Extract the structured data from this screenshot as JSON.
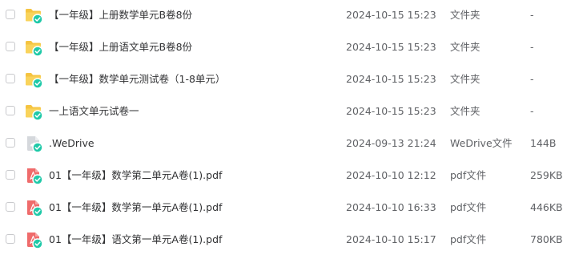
{
  "colors": {
    "folder": "#f5c441",
    "pdf": "#ef6b6b",
    "generic": "#d5d8dc",
    "sync_badge": "#1fc9a8",
    "text": "#303133",
    "muted": "#606266"
  },
  "files": [
    {
      "name": "【一年级】上册数学单元B卷8份",
      "modified": "2024-10-15 15:23",
      "type": "文件夹",
      "size": "-",
      "icon": "folder-icon"
    },
    {
      "name": "【一年级】上册语文单元B卷8份",
      "modified": "2024-10-15 15:23",
      "type": "文件夹",
      "size": "-",
      "icon": "folder-icon"
    },
    {
      "name": "【一年级】数学单元测试卷（1-8单元）",
      "modified": "2024-10-15 15:23",
      "type": "文件夹",
      "size": "-",
      "icon": "folder-icon"
    },
    {
      "name": "一上语文单元试卷一",
      "modified": "2024-10-15 15:23",
      "type": "文件夹",
      "size": "-",
      "icon": "folder-icon"
    },
    {
      "name": ".WeDrive",
      "modified": "2024-09-13 21:24",
      "type": "WeDrive文件",
      "size": "144B",
      "icon": "generic-file-icon"
    },
    {
      "name": "01【一年级】数学第二单元A卷(1).pdf",
      "modified": "2024-10-10 12:12",
      "type": "pdf文件",
      "size": "259KB",
      "icon": "pdf-icon"
    },
    {
      "name": "01【一年级】数学第一单元A卷(1).pdf",
      "modified": "2024-10-10 16:33",
      "type": "pdf文件",
      "size": "446KB",
      "icon": "pdf-icon"
    },
    {
      "name": "01【一年级】语文第一单元A卷(1).pdf",
      "modified": "2024-10-10 15:17",
      "type": "pdf文件",
      "size": "780KB",
      "icon": "pdf-icon"
    }
  ]
}
